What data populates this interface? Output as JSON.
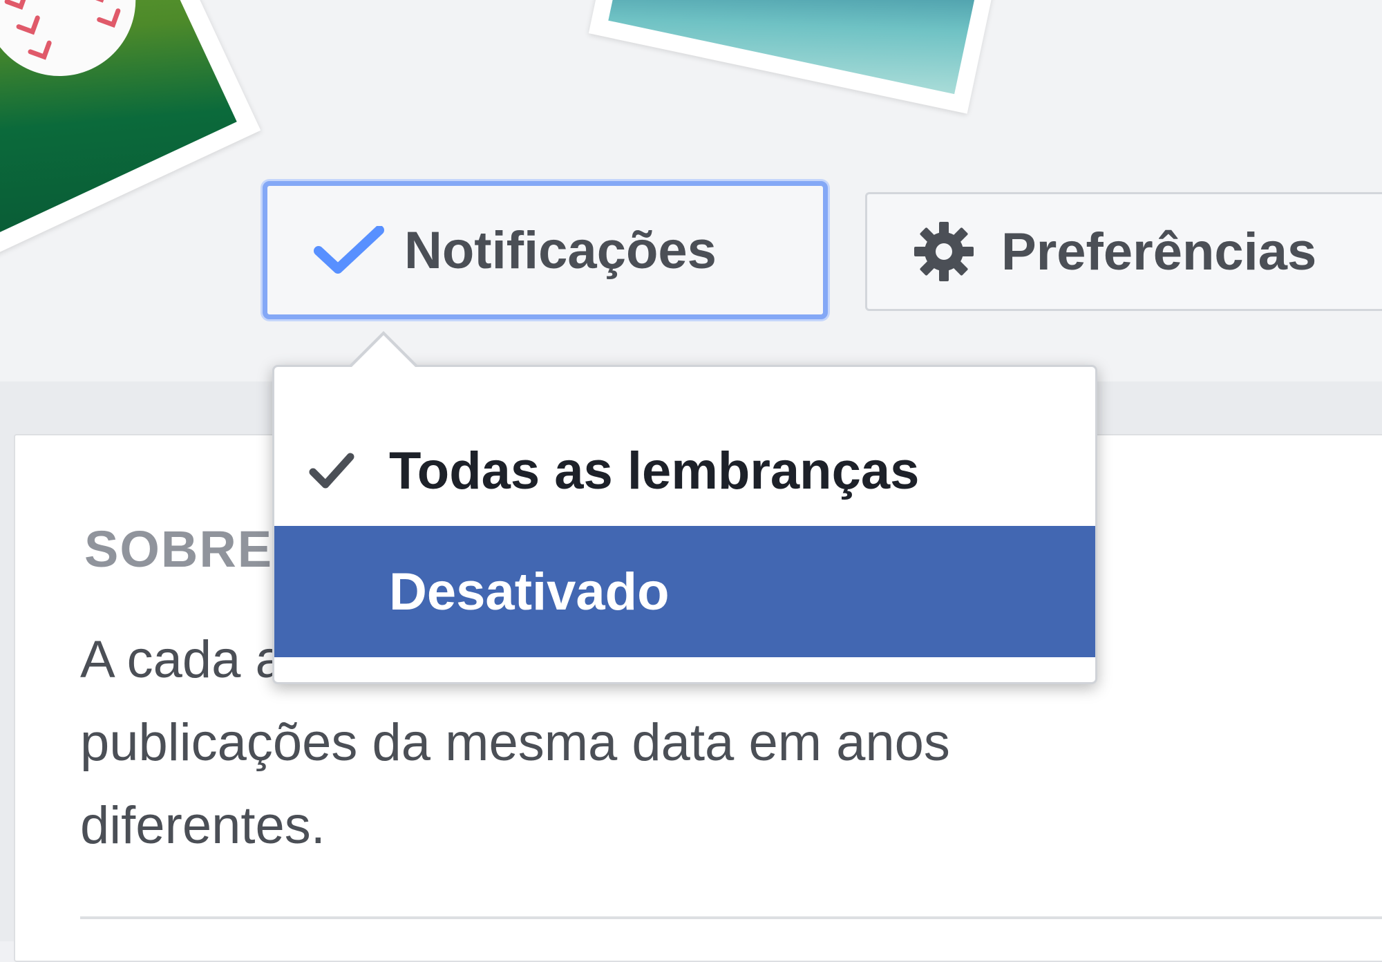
{
  "header": {
    "notifications_button": {
      "label": "Notificações",
      "icon": "check-icon",
      "color": "#5890ff"
    },
    "preferences_button": {
      "label": "Preferências",
      "icon": "gear-icon"
    }
  },
  "dropdown": {
    "items": [
      {
        "label": "Todas as lembranças",
        "selected": true,
        "icon": "check-icon"
      },
      {
        "label": "Desativado",
        "selected": false,
        "highlighted": true
      }
    ],
    "highlight_color": "#4267b2"
  },
  "about_section": {
    "title": "SOBRE",
    "description": "A cada       as as suas\npublicações da mesma data em anos\ndiferentes."
  }
}
